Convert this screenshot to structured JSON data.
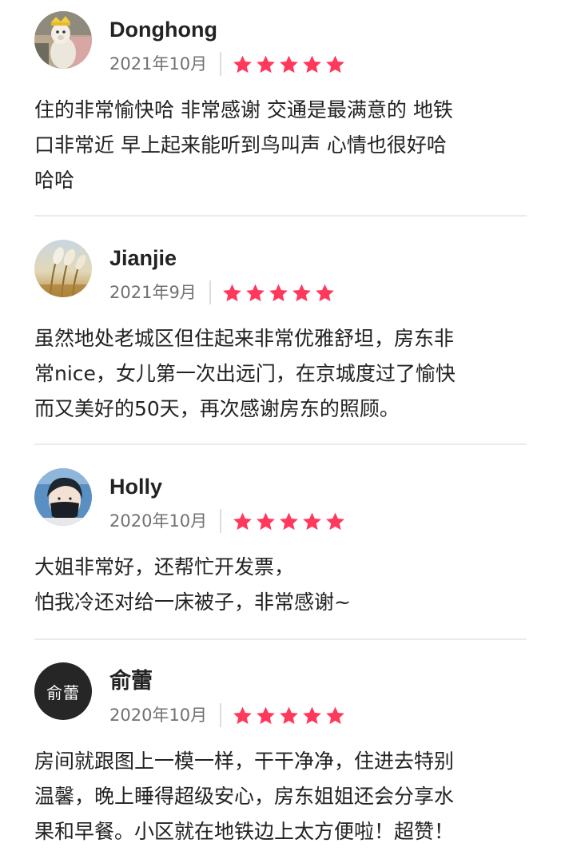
{
  "colors": {
    "star": "#FF385C",
    "date": "#717171",
    "text": "#222222",
    "divider": "#EBEBEB",
    "initials_avatar_bg": "#262626"
  },
  "reviews": [
    {
      "name": "Donghong",
      "date": "2021年10月",
      "rating": 5,
      "avatar": "photo-alpaca",
      "text": "住的非常愉快哈 非常感谢 交通是最满意的 地铁\n口非常近 早上起来能听到鸟叫声 心情也很好哈\n哈哈"
    },
    {
      "name": "Jianjie",
      "date": "2021年9月",
      "rating": 5,
      "avatar": "photo-reeds",
      "text": "虽然地处老城区但住起来非常优雅舒坦，房东非\n常nice，女儿第一次出远门，在京城度过了愉快\n而又美好的50天，再次感谢房东的照顾。"
    },
    {
      "name": "Holly",
      "date": "2020年10月",
      "rating": 5,
      "avatar": "photo-person-mask",
      "text": "大姐非常好，还帮忙开发票，\n怕我冷还对给一床被子，非常感谢~"
    },
    {
      "name": "俞蕾",
      "date": "2020年10月",
      "rating": 5,
      "avatar_initials": "俞蕾",
      "text": "房间就跟图上一模一样，干干净净，住进去特别\n温馨，晚上睡得超级安心，房东姐姐还会分享水\n果和早餐。小区就在地铁边上太方便啦！超赞！"
    }
  ]
}
